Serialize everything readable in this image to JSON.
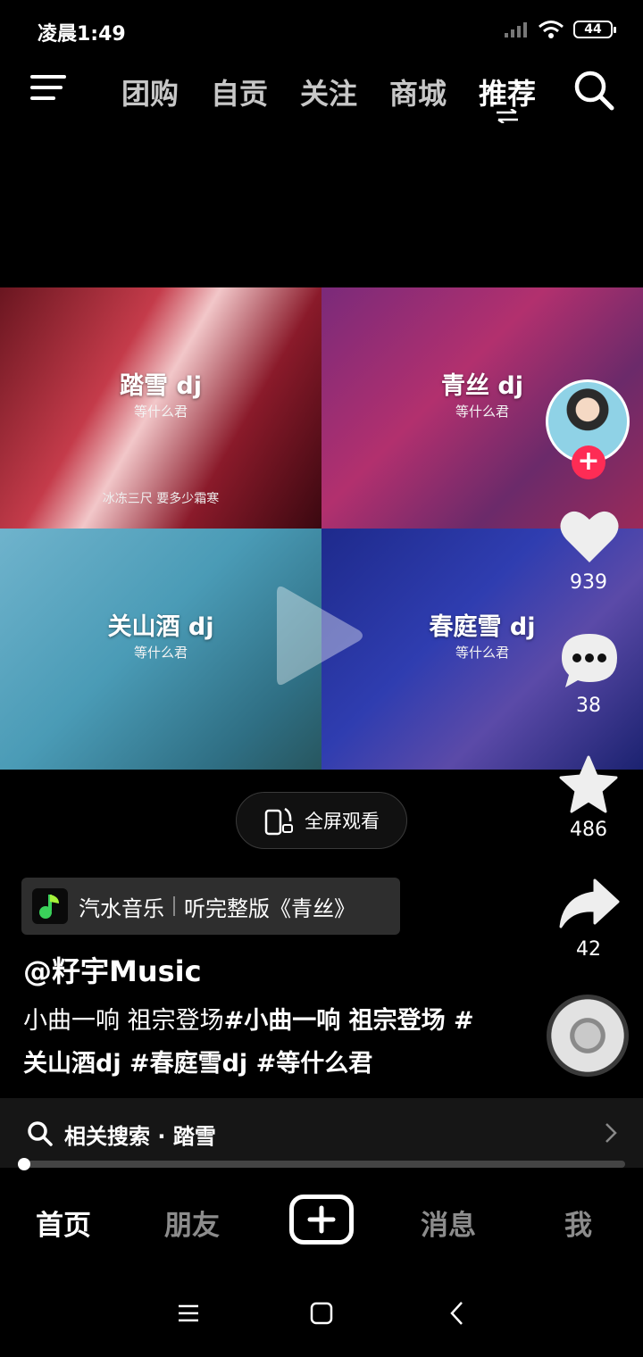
{
  "status_bar": {
    "time": "凌晨1:49",
    "battery": "44"
  },
  "top_nav": {
    "tabs": [
      {
        "label": "团购"
      },
      {
        "label": "自贡"
      },
      {
        "label": "关注"
      },
      {
        "label": "商城"
      },
      {
        "label": "推荐",
        "active": true
      }
    ]
  },
  "video": {
    "tiles": [
      {
        "title": "踏雪 dj",
        "subtitle": "等什么君",
        "lyric": "冰冻三尺 要多少霜寒"
      },
      {
        "title": "青丝 dj",
        "subtitle": "等什么君"
      },
      {
        "title": "关山酒 dj",
        "subtitle": "等什么君"
      },
      {
        "title": "春庭雪 dj",
        "subtitle": "等什么君"
      }
    ],
    "fullscreen_label": "全屏观看"
  },
  "actions": {
    "likes": "939",
    "comments": "38",
    "favorites": "486",
    "shares": "42"
  },
  "music_banner": {
    "app": "汽水音乐",
    "action": "听完整版《青丝》"
  },
  "author": "@籽宇Music",
  "caption": {
    "text": "小曲一响 祖宗登场",
    "tags": "#小曲一响 祖宗登场 #关山酒dj #春庭雪dj #等什么君"
  },
  "related_search": {
    "label": "相关搜索 · 踏雪"
  },
  "progress": 0.01,
  "bottom_nav": {
    "tabs": [
      "首页",
      "朋友",
      "消息",
      "我"
    ],
    "active": "首页"
  },
  "colors": {
    "accent": "#fe2c55",
    "background": "#000000"
  }
}
